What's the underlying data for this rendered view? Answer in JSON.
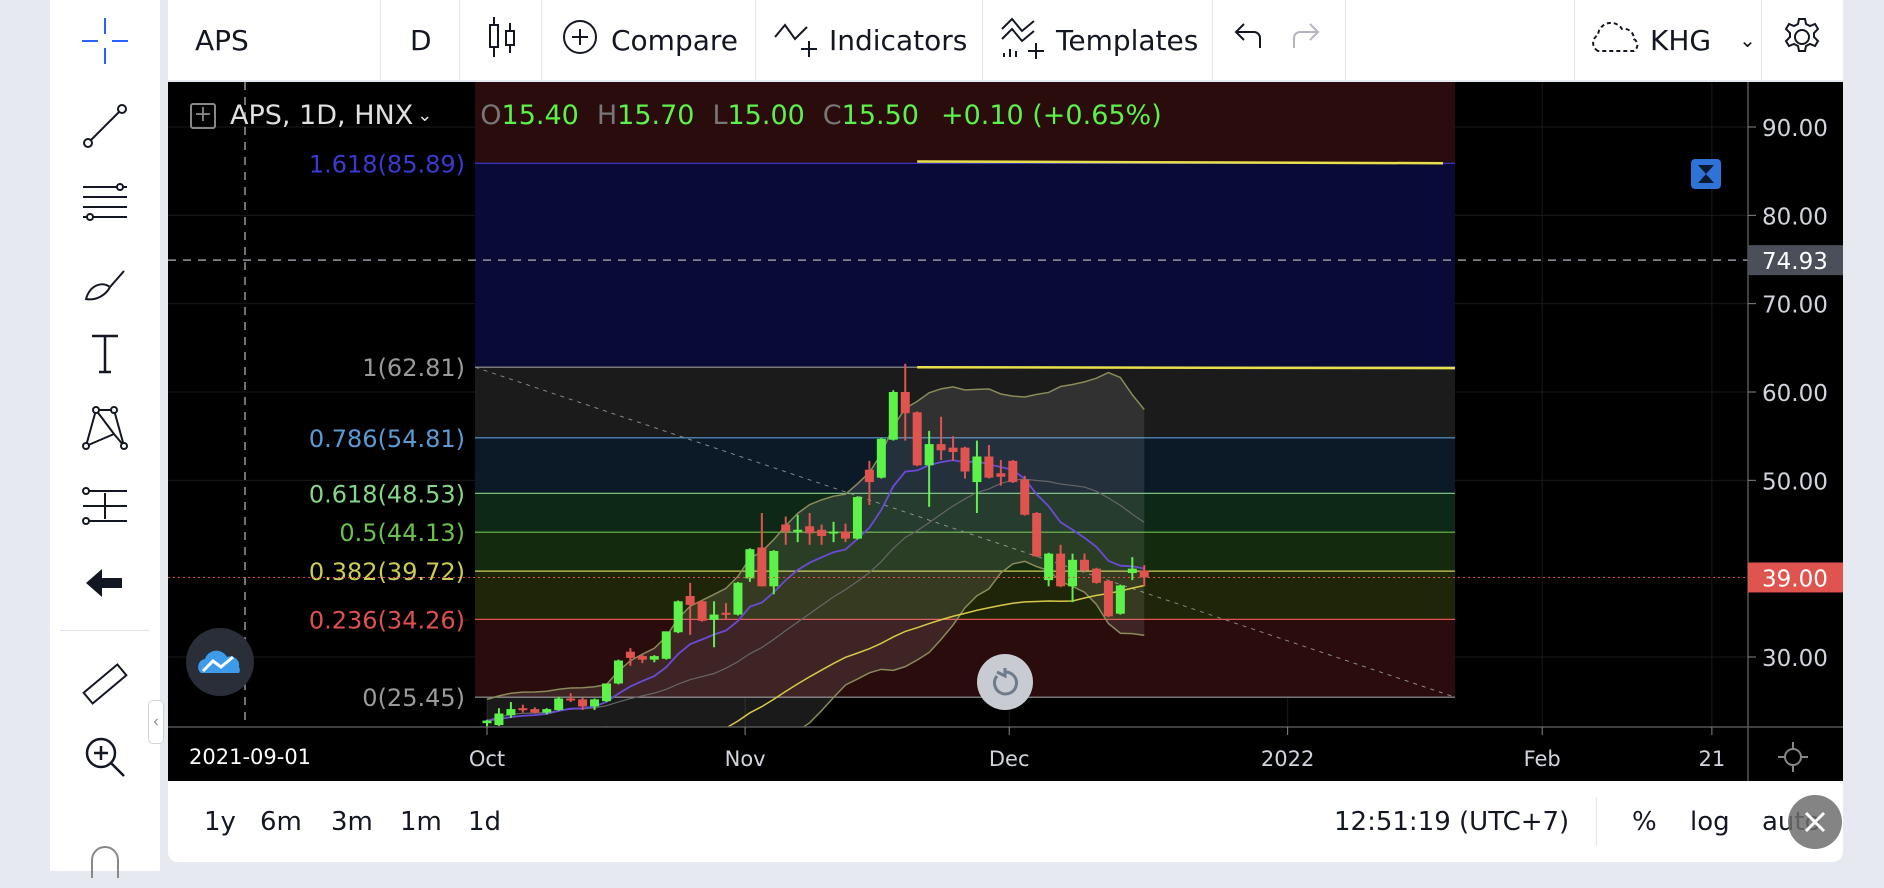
{
  "toolbar": {
    "symbol": "APS",
    "interval": "D",
    "compare": "Compare",
    "indicators": "Indicators",
    "templates": "Templates",
    "account": "KHG"
  },
  "legend": {
    "title": "APS, 1D, HNX",
    "o_label": "O",
    "o": "15.40",
    "h_label": "H",
    "h": "15.70",
    "l_label": "L",
    "l": "15.00",
    "c_label": "C",
    "c": "15.50",
    "change": "+0.10 (+0.65%)"
  },
  "bottom": {
    "ranges": [
      "1y",
      "6m",
      "3m",
      "1m",
      "1d"
    ],
    "clock": "12:51:19 (UTC+7)",
    "percent": "%",
    "log": "log",
    "auto": "auto"
  },
  "colors": {
    "up": "#5df24a",
    "down": "#e0544f",
    "bg": "#000000",
    "crosshair_label": "#4a4f5a",
    "last_price": "#e0544f"
  },
  "chart_data": {
    "type": "candlestick",
    "symbol": "APS",
    "interval": "1D",
    "exchange": "HNX",
    "ylim": [
      22,
      93
    ],
    "y_ticks": [
      "90.00",
      "80.00",
      "70.00",
      "60.00",
      "50.00",
      "30.00"
    ],
    "y_tick_values": [
      90,
      80,
      70,
      60,
      50,
      30
    ],
    "x_ticks": [
      {
        "label": "Oct",
        "bar": 0
      },
      {
        "label": "Nov",
        "bar": 21.6
      },
      {
        "label": "Dec",
        "bar": 43.7
      },
      {
        "label": "2022",
        "bar": 67
      },
      {
        "label": "Feb",
        "bar": 88.3
      },
      {
        "label": "21",
        "bar": 102.5
      }
    ],
    "crosshair": {
      "price": "74.93",
      "date": "2021-09-01"
    },
    "last_price": "39.00",
    "fib_levels": [
      {
        "ratio": "1.618",
        "price": 85.89,
        "label": "1.618(85.89)",
        "color": "#3a3ad0",
        "fill": "#0a0a36"
      },
      {
        "ratio": "1",
        "price": 62.81,
        "label": "1(62.81)",
        "color": "#9a9a9a",
        "fill": "#1b1b1b"
      },
      {
        "ratio": "0.786",
        "price": 54.81,
        "label": "0.786(54.81)",
        "color": "#5b9bd5",
        "fill": "#0c1a28"
      },
      {
        "ratio": "0.618",
        "price": 48.53,
        "label": "0.618(48.53)",
        "color": "#86d68a",
        "fill": "#0e2818"
      },
      {
        "ratio": "0.5",
        "price": 44.13,
        "label": "0.5(44.13)",
        "color": "#6cc04a",
        "fill": "#132a0e"
      },
      {
        "ratio": "0.382",
        "price": 39.72,
        "label": "0.382(39.72)",
        "color": "#cdcd55",
        "fill": "#1f2508"
      },
      {
        "ratio": "0.236",
        "price": 34.26,
        "label": "0.236(34.26)",
        "color": "#e05050",
        "fill": "#2a0c0c"
      },
      {
        "ratio": "0",
        "price": 25.45,
        "label": "0(25.45)",
        "color": "#9a9a9a",
        "fill": null
      }
    ],
    "fib_top_fill": "#2a0c0c",
    "hlines": [
      {
        "price_start": 86.1,
        "price_end": 85.9,
        "bar_start": 36,
        "bar_end": 80,
        "color": "#e8e04a"
      },
      {
        "price_start": 62.8,
        "price_end": 62.7,
        "bar_start": 36,
        "bar_end": 81,
        "color": "#e8e04a"
      }
    ],
    "candles": [
      [
        22.5,
        22.9,
        22.1,
        22.8
      ],
      [
        22.3,
        24.2,
        22.2,
        23.6
      ],
      [
        23.4,
        24.9,
        23.1,
        24.1
      ],
      [
        24.2,
        24.6,
        23.7,
        24.0
      ],
      [
        24.1,
        24.3,
        23.6,
        23.7
      ],
      [
        23.7,
        24.2,
        23.5,
        24.1
      ],
      [
        24.0,
        25.5,
        23.9,
        25.3
      ],
      [
        25.3,
        25.9,
        24.9,
        25.1
      ],
      [
        25.2,
        25.4,
        24.0,
        24.4
      ],
      [
        24.4,
        25.3,
        24.0,
        25.2
      ],
      [
        25.0,
        27.0,
        24.9,
        27.0
      ],
      [
        27.0,
        29.7,
        26.9,
        29.6
      ],
      [
        30.6,
        31.0,
        29.0,
        29.9
      ],
      [
        30.1,
        30.3,
        29.3,
        29.7
      ],
      [
        29.7,
        30.2,
        29.4,
        30.1
      ],
      [
        29.8,
        32.9,
        29.7,
        32.9
      ],
      [
        32.8,
        36.4,
        32.7,
        36.3
      ],
      [
        36.9,
        38.4,
        32.5,
        35.9
      ],
      [
        36.3,
        36.4,
        34.0,
        34.1
      ],
      [
        34.2,
        36.3,
        31.1,
        34.8
      ],
      [
        35.0,
        36.1,
        34.2,
        34.8
      ],
      [
        34.8,
        38.5,
        34.7,
        38.4
      ],
      [
        38.9,
        42.3,
        38.5,
        42.2
      ],
      [
        42.4,
        46.3,
        38.0,
        38.0
      ],
      [
        38.0,
        42.1,
        37.1,
        42.0
      ],
      [
        45.0,
        45.9,
        42.7,
        44.2
      ],
      [
        44.3,
        46.1,
        43.0,
        44.4
      ],
      [
        44.8,
        46.3,
        42.7,
        44.0
      ],
      [
        44.4,
        45.0,
        42.7,
        43.7
      ],
      [
        44.1,
        45.3,
        43.0,
        44.2
      ],
      [
        44.2,
        45.1,
        43.0,
        43.4
      ],
      [
        43.4,
        48.2,
        43.3,
        48.1
      ],
      [
        51.2,
        52.2,
        47.2,
        49.8
      ],
      [
        50.3,
        54.8,
        50.2,
        54.7
      ],
      [
        54.6,
        60.2,
        54.5,
        60.0
      ],
      [
        60.0,
        63.2,
        54.5,
        57.6
      ],
      [
        57.7,
        57.8,
        51.6,
        51.7
      ],
      [
        51.7,
        55.6,
        47.0,
        54.1
      ],
      [
        54.1,
        57.2,
        52.3,
        53.4
      ],
      [
        53.7,
        55.0,
        52.2,
        53.2
      ],
      [
        53.7,
        53.8,
        50.2,
        51.0
      ],
      [
        49.8,
        54.5,
        46.3,
        52.7
      ],
      [
        52.7,
        54.0,
        50.2,
        50.3
      ],
      [
        50.8,
        52.3,
        49.4,
        50.4
      ],
      [
        52.2,
        52.3,
        49.7,
        49.8
      ],
      [
        50.1,
        50.5,
        46.0,
        46.1
      ],
      [
        46.3,
        46.4,
        41.3,
        41.4
      ],
      [
        38.7,
        41.8,
        38.0,
        41.7
      ],
      [
        41.7,
        42.7,
        37.9,
        38.0
      ],
      [
        38.0,
        41.7,
        36.2,
        41.0
      ],
      [
        41.0,
        41.7,
        39.7,
        39.8
      ],
      [
        40.0,
        40.1,
        38.3,
        38.4
      ],
      [
        38.6,
        38.7,
        34.5,
        34.6
      ],
      [
        34.9,
        38.2,
        34.8,
        38.1
      ],
      [
        39.5,
        41.3,
        38.7,
        40.0
      ],
      [
        39.8,
        40.4,
        38.0,
        39.0
      ]
    ]
  }
}
